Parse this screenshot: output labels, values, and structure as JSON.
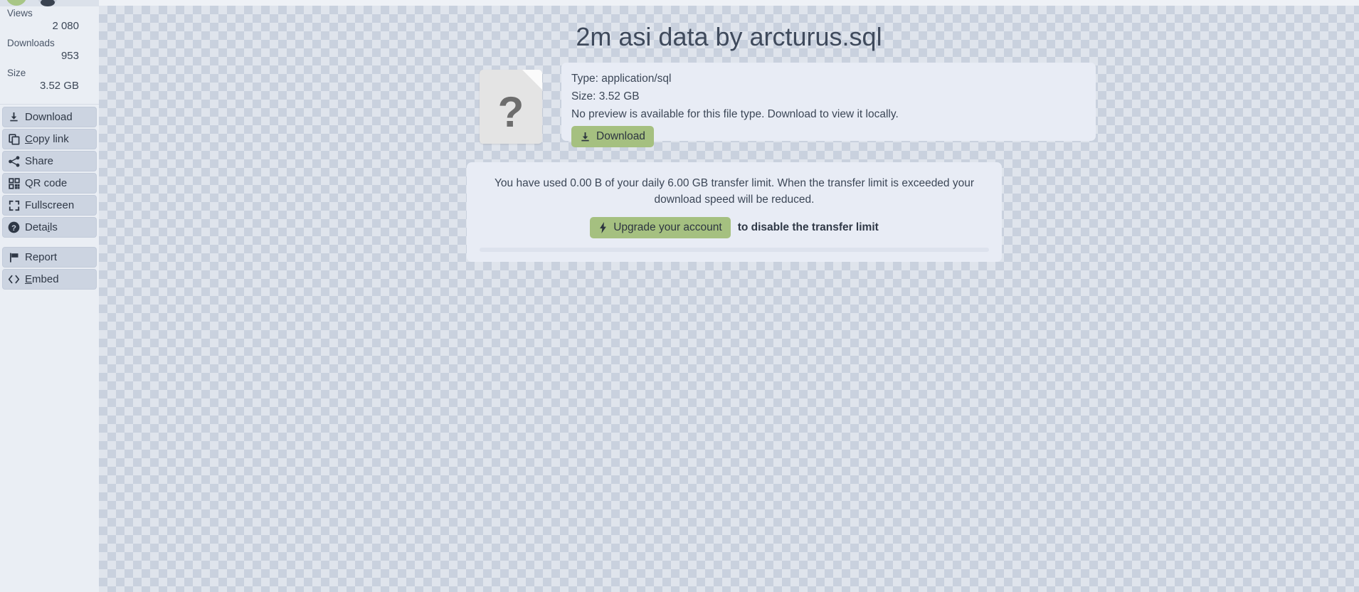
{
  "sidebar": {
    "stats": [
      {
        "label": "Views",
        "value": "2 080"
      },
      {
        "label": "Downloads",
        "value": "953"
      },
      {
        "label": "Size",
        "value": "3.52 GB"
      }
    ],
    "actions": [
      {
        "icon": "download-icon",
        "label": "Download"
      },
      {
        "icon": "copy-icon",
        "label": "Copy link"
      },
      {
        "icon": "share-icon",
        "label": "Share"
      },
      {
        "icon": "qr-code-icon",
        "label": "QR code"
      },
      {
        "icon": "fullscreen-icon",
        "label": "Fullscreen"
      },
      {
        "icon": "question-circle-icon",
        "label": "Details"
      }
    ],
    "secondary_actions": [
      {
        "icon": "flag-icon",
        "label": "Report"
      },
      {
        "icon": "code-brackets-icon",
        "label": "Embed"
      }
    ]
  },
  "main": {
    "title": "2m asi data by arcturus.sql",
    "file_card": {
      "icon": "unknown-file-icon",
      "icon_glyph": "?",
      "type_line": "Type: application/sql",
      "size_line": "Size: 3.52 GB",
      "preview_line": "No preview is available for this file type. Download to view it locally.",
      "download_label": "Download",
      "download_icon": "download-icon"
    },
    "limit_card": {
      "message": "You have used 0.00 B of your daily 6.00 GB transfer limit. When the transfer limit is exceeded your download speed will be reduced.",
      "upgrade_label": "Upgrade your account",
      "upgrade_icon": "lightning-bolt-icon",
      "upgrade_note": "to disable the transfer limit"
    }
  },
  "colors": {
    "accent_green": "#a5c080",
    "card_bg": "#e8ecf5",
    "sidebar_bg": "#eaeef4",
    "button_bg": "#ccd4e1",
    "text": "#3c4757"
  }
}
